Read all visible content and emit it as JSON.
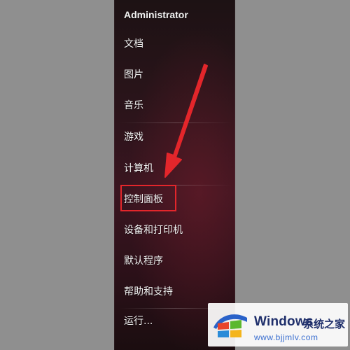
{
  "start_menu": {
    "items": [
      {
        "label": "Administrator"
      },
      {
        "label": "文档"
      },
      {
        "label": "图片"
      },
      {
        "label": "音乐"
      },
      {
        "label": "游戏"
      },
      {
        "label": "计算机"
      },
      {
        "label": "控制面板"
      },
      {
        "label": "设备和打印机"
      },
      {
        "label": "默认程序"
      },
      {
        "label": "帮助和支持"
      },
      {
        "label": "运行..."
      }
    ],
    "highlight_color": "#e3262b"
  },
  "watermark": {
    "brand": "Windows",
    "brand_cn": "系统之家",
    "url": "www.bjjmlv.com"
  }
}
